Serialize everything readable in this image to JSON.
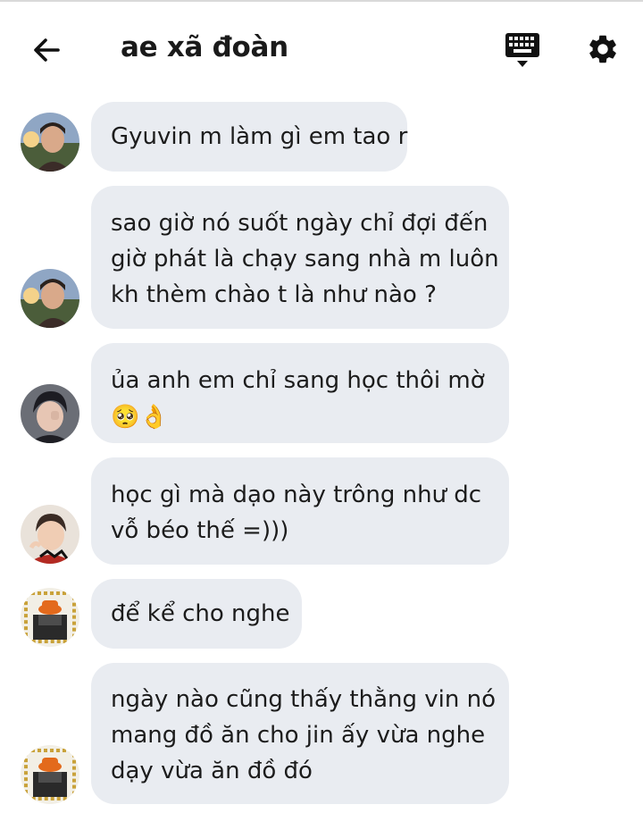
{
  "header": {
    "title": "ae xã đoàn",
    "back_icon": "arrow-left-icon",
    "keyboard_icon": "keyboard-icon",
    "settings_icon": "gear-icon"
  },
  "messages": [
    {
      "lines": [
        "Gyuvin m làm gì em tao r"
      ],
      "avatar": "avatar-outdoor-portrait"
    },
    {
      "lines": [
        "sao giờ nó suốt ngày chỉ đợi đến",
        "giờ phát là chạy sang nhà m luôn",
        "kh thèm chào t là như nào ?"
      ],
      "avatar": "avatar-outdoor-portrait"
    },
    {
      "lines": [
        "ủa anh em chỉ sang học thôi mờ"
      ],
      "emojis": "🥺👌",
      "avatar": "avatar-dark-hair"
    },
    {
      "lines": [
        "học gì mà dạo này trông như dc",
        "vỗ béo thế =)))"
      ],
      "avatar": "avatar-smiling-boy"
    },
    {
      "lines": [
        "để kể cho nghe"
      ],
      "avatar": "avatar-orange-hat"
    },
    {
      "lines": [
        "ngày nào cũng thấy thằng vin nó",
        "mang đồ ăn cho jin ấy vừa nghe",
        "dạy vừa ăn đồ đó"
      ],
      "avatar": "avatar-orange-hat"
    }
  ],
  "colors": {
    "bubble": "#e9ecf1",
    "text": "#1c1c1c",
    "icon": "#111111"
  }
}
